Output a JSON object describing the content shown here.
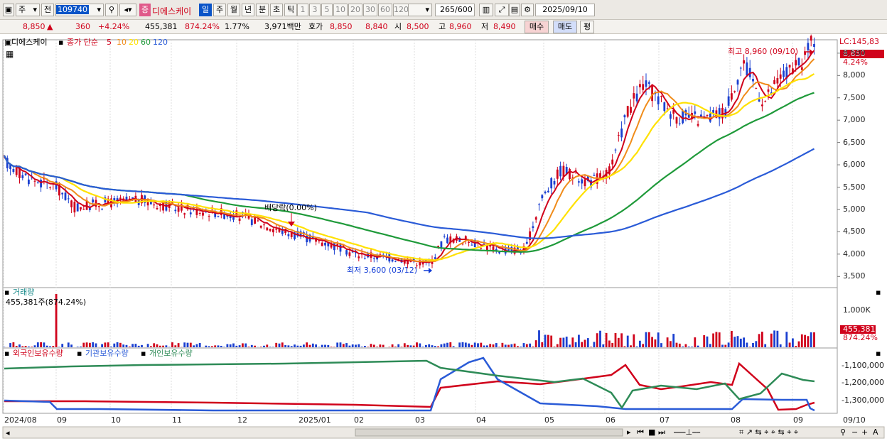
{
  "toolbar": {
    "type_select": "주",
    "prev_label": "전",
    "code": "109740",
    "stock_badge": "증",
    "stock_name": "디에스케이",
    "periods": [
      "일",
      "주",
      "월",
      "년",
      "분",
      "초",
      "틱"
    ],
    "selected_period": "일",
    "intervals": [
      "1",
      "3",
      "5",
      "10",
      "20",
      "30",
      "60",
      "120"
    ],
    "count": "265",
    "count_max": "/600",
    "date": "2025/09/10"
  },
  "quote": {
    "price": "8,850",
    "change_arrow": "▲",
    "change": "360",
    "change_pct": "+4.24%",
    "volume": "455,381",
    "vol_ratio": "874.24%",
    "turnover": "1.77%",
    "amount": "3,971백만",
    "hoga_label": "호가",
    "ask": "8,850",
    "bid": "8,840",
    "open_label": "시",
    "open": "8,500",
    "high_label": "고",
    "high": "8,960",
    "low_label": "저",
    "low": "8,490",
    "buy": "매수",
    "sell": "매도",
    "eval": "평"
  },
  "price_panel": {
    "stock_name": "디에스케이",
    "legend_prefix": "종가 단순",
    "ma_periods": [
      "5",
      "10",
      "20",
      "60",
      "120"
    ],
    "ma_colors": [
      "#d0021b",
      "#f08c1a",
      "#ffe100",
      "#1f9a3a",
      "#2a5bd7"
    ],
    "lc_label": "LC:145,83",
    "last_price_tag": "8,850",
    "last_pct_tag": "4.24%",
    "high_note": "최고 8,960 (09/10)",
    "low_note": "최저 3,600 (03/12)",
    "dividend_note": "배당락(0.00%)",
    "y_ticks": [
      "8,500",
      "8,000",
      "7,500",
      "7,000",
      "6,500",
      "6,000",
      "5,500",
      "5,000",
      "4,500",
      "4,000",
      "3,500"
    ]
  },
  "volume_panel": {
    "title": "거래량",
    "current": "455,381주(874.24%)",
    "y_tick": "1,000K",
    "tag_value": "455,381",
    "tag_pct": "874.24%"
  },
  "holding_panel": {
    "series": [
      {
        "name": "외국인보유수량",
        "color": "#d0021b"
      },
      {
        "name": "기관보유수량",
        "color": "#2a5bd7"
      },
      {
        "name": "개인보유수량",
        "color": "#2e8b57"
      }
    ],
    "y_ticks": [
      "-1,100,000",
      "-1,200,000",
      "-1,300,000"
    ]
  },
  "x_axis": {
    "labels": [
      "2024/08",
      "09",
      "10",
      "11",
      "12",
      "2025/01",
      "02",
      "03",
      "04",
      "05",
      "06",
      "07",
      "08",
      "09"
    ],
    "right_label": "09/10"
  }
}
